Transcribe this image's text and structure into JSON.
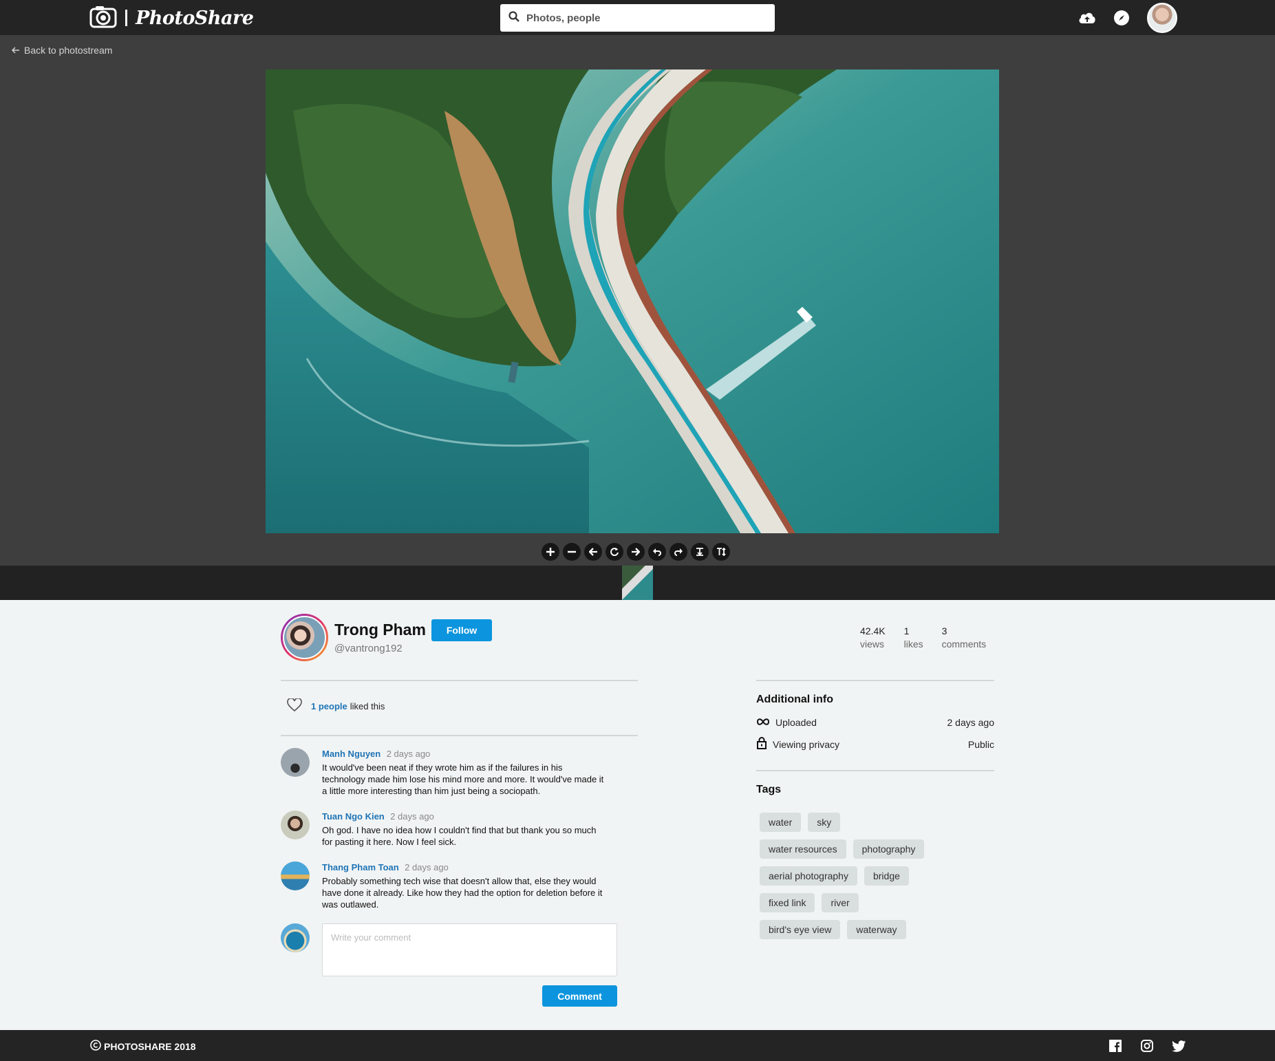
{
  "header": {
    "brand": "PhotoShare",
    "search_placeholder": "Photos, people",
    "icons": [
      "camera-logo-icon",
      "upload-cloud-icon",
      "compass-icon",
      "user-avatar"
    ]
  },
  "viewer": {
    "back_label": "Back to photostream",
    "toolbar": [
      "zoom-in",
      "zoom-out",
      "previous",
      "reset",
      "next",
      "rotate-left",
      "rotate-right",
      "flip-horizontal",
      "flip-vertical"
    ]
  },
  "owner": {
    "name": "Trong Pham",
    "handle": "@vantrong192",
    "follow_label": "Follow"
  },
  "stats": [
    {
      "value": "42.4K",
      "label": "views"
    },
    {
      "value": "1",
      "label": "likes"
    },
    {
      "value": "3",
      "label": "comments"
    }
  ],
  "likes": {
    "count_text": "1 people",
    "suffix": "liked this"
  },
  "comments": [
    {
      "author": "Manh Nguyen",
      "time": "2 days ago",
      "text": "It would've been neat if they wrote him as if the failures in his technology made him lose his mind more and more. It would've made it a little more interesting than him just being a sociopath."
    },
    {
      "author": "Tuan Ngo Kien",
      "time": "2 days ago",
      "text": "Oh god. I have no idea how I couldn't find that but thank you so much for pasting it here. Now I feel sick."
    },
    {
      "author": "Thang Pham Toan",
      "time": "2 days ago",
      "text": "Probably something tech wise that doesn't allow that, else they would have done it already. Like how they had the option for deletion before it was outlawed."
    }
  ],
  "comment_form": {
    "placeholder": "Write your comment",
    "submit_label": "Comment"
  },
  "info": {
    "title": "Additional info",
    "rows": [
      {
        "label": "Uploaded",
        "value": "2 days ago",
        "icon": "infinity-icon"
      },
      {
        "label": "Viewing privacy",
        "value": "Public",
        "icon": "lock-icon"
      }
    ]
  },
  "tags": {
    "title": "Tags",
    "rows": [
      [
        "water",
        "sky"
      ],
      [
        "water resources",
        "photography"
      ],
      [
        "aerial photography",
        "bridge"
      ],
      [
        "fixed link",
        "river"
      ],
      [
        "bird's eye view",
        "waterway"
      ]
    ]
  },
  "footer": {
    "copyright": "PHOTOSHARE 2018",
    "social": [
      "facebook-icon",
      "instagram-icon",
      "twitter-icon"
    ]
  },
  "colors": {
    "accent": "#0c95de",
    "link": "#1f74b6",
    "nav_bg": "#242424",
    "viewer_bg": "#3e3e3e",
    "page_bg": "#f1f4f4"
  }
}
